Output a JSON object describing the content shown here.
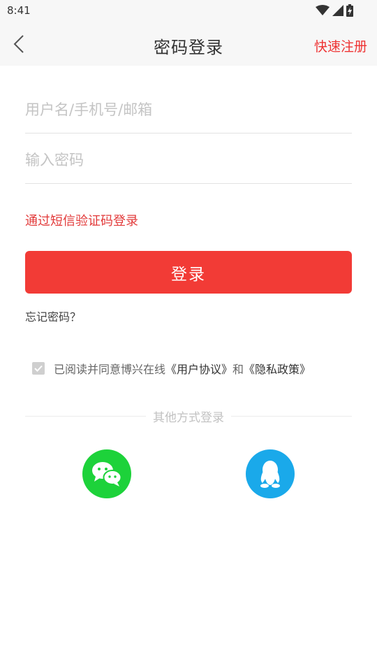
{
  "status": {
    "time": "8:41"
  },
  "nav": {
    "title": "密码登录",
    "register": "快速注册"
  },
  "form": {
    "username_placeholder": "用户名/手机号/邮箱",
    "username_value": "",
    "password_placeholder": "输入密码",
    "password_value": "",
    "sms_login": "通过短信验证码登录",
    "login_button": "登录",
    "forgot_password": "忘记密码？"
  },
  "agreement": {
    "text": "已阅读并同意博兴在线",
    "user_agreement": "《用户协议》",
    "and": "和",
    "privacy_policy": "《隐私政策》"
  },
  "other_login": {
    "label": "其他方式登录",
    "icons": [
      "wechat-icon",
      "qq-icon"
    ]
  },
  "colors": {
    "accent": "#f23b36",
    "wechat": "#1dd23a",
    "qq": "#1aa9ea"
  }
}
